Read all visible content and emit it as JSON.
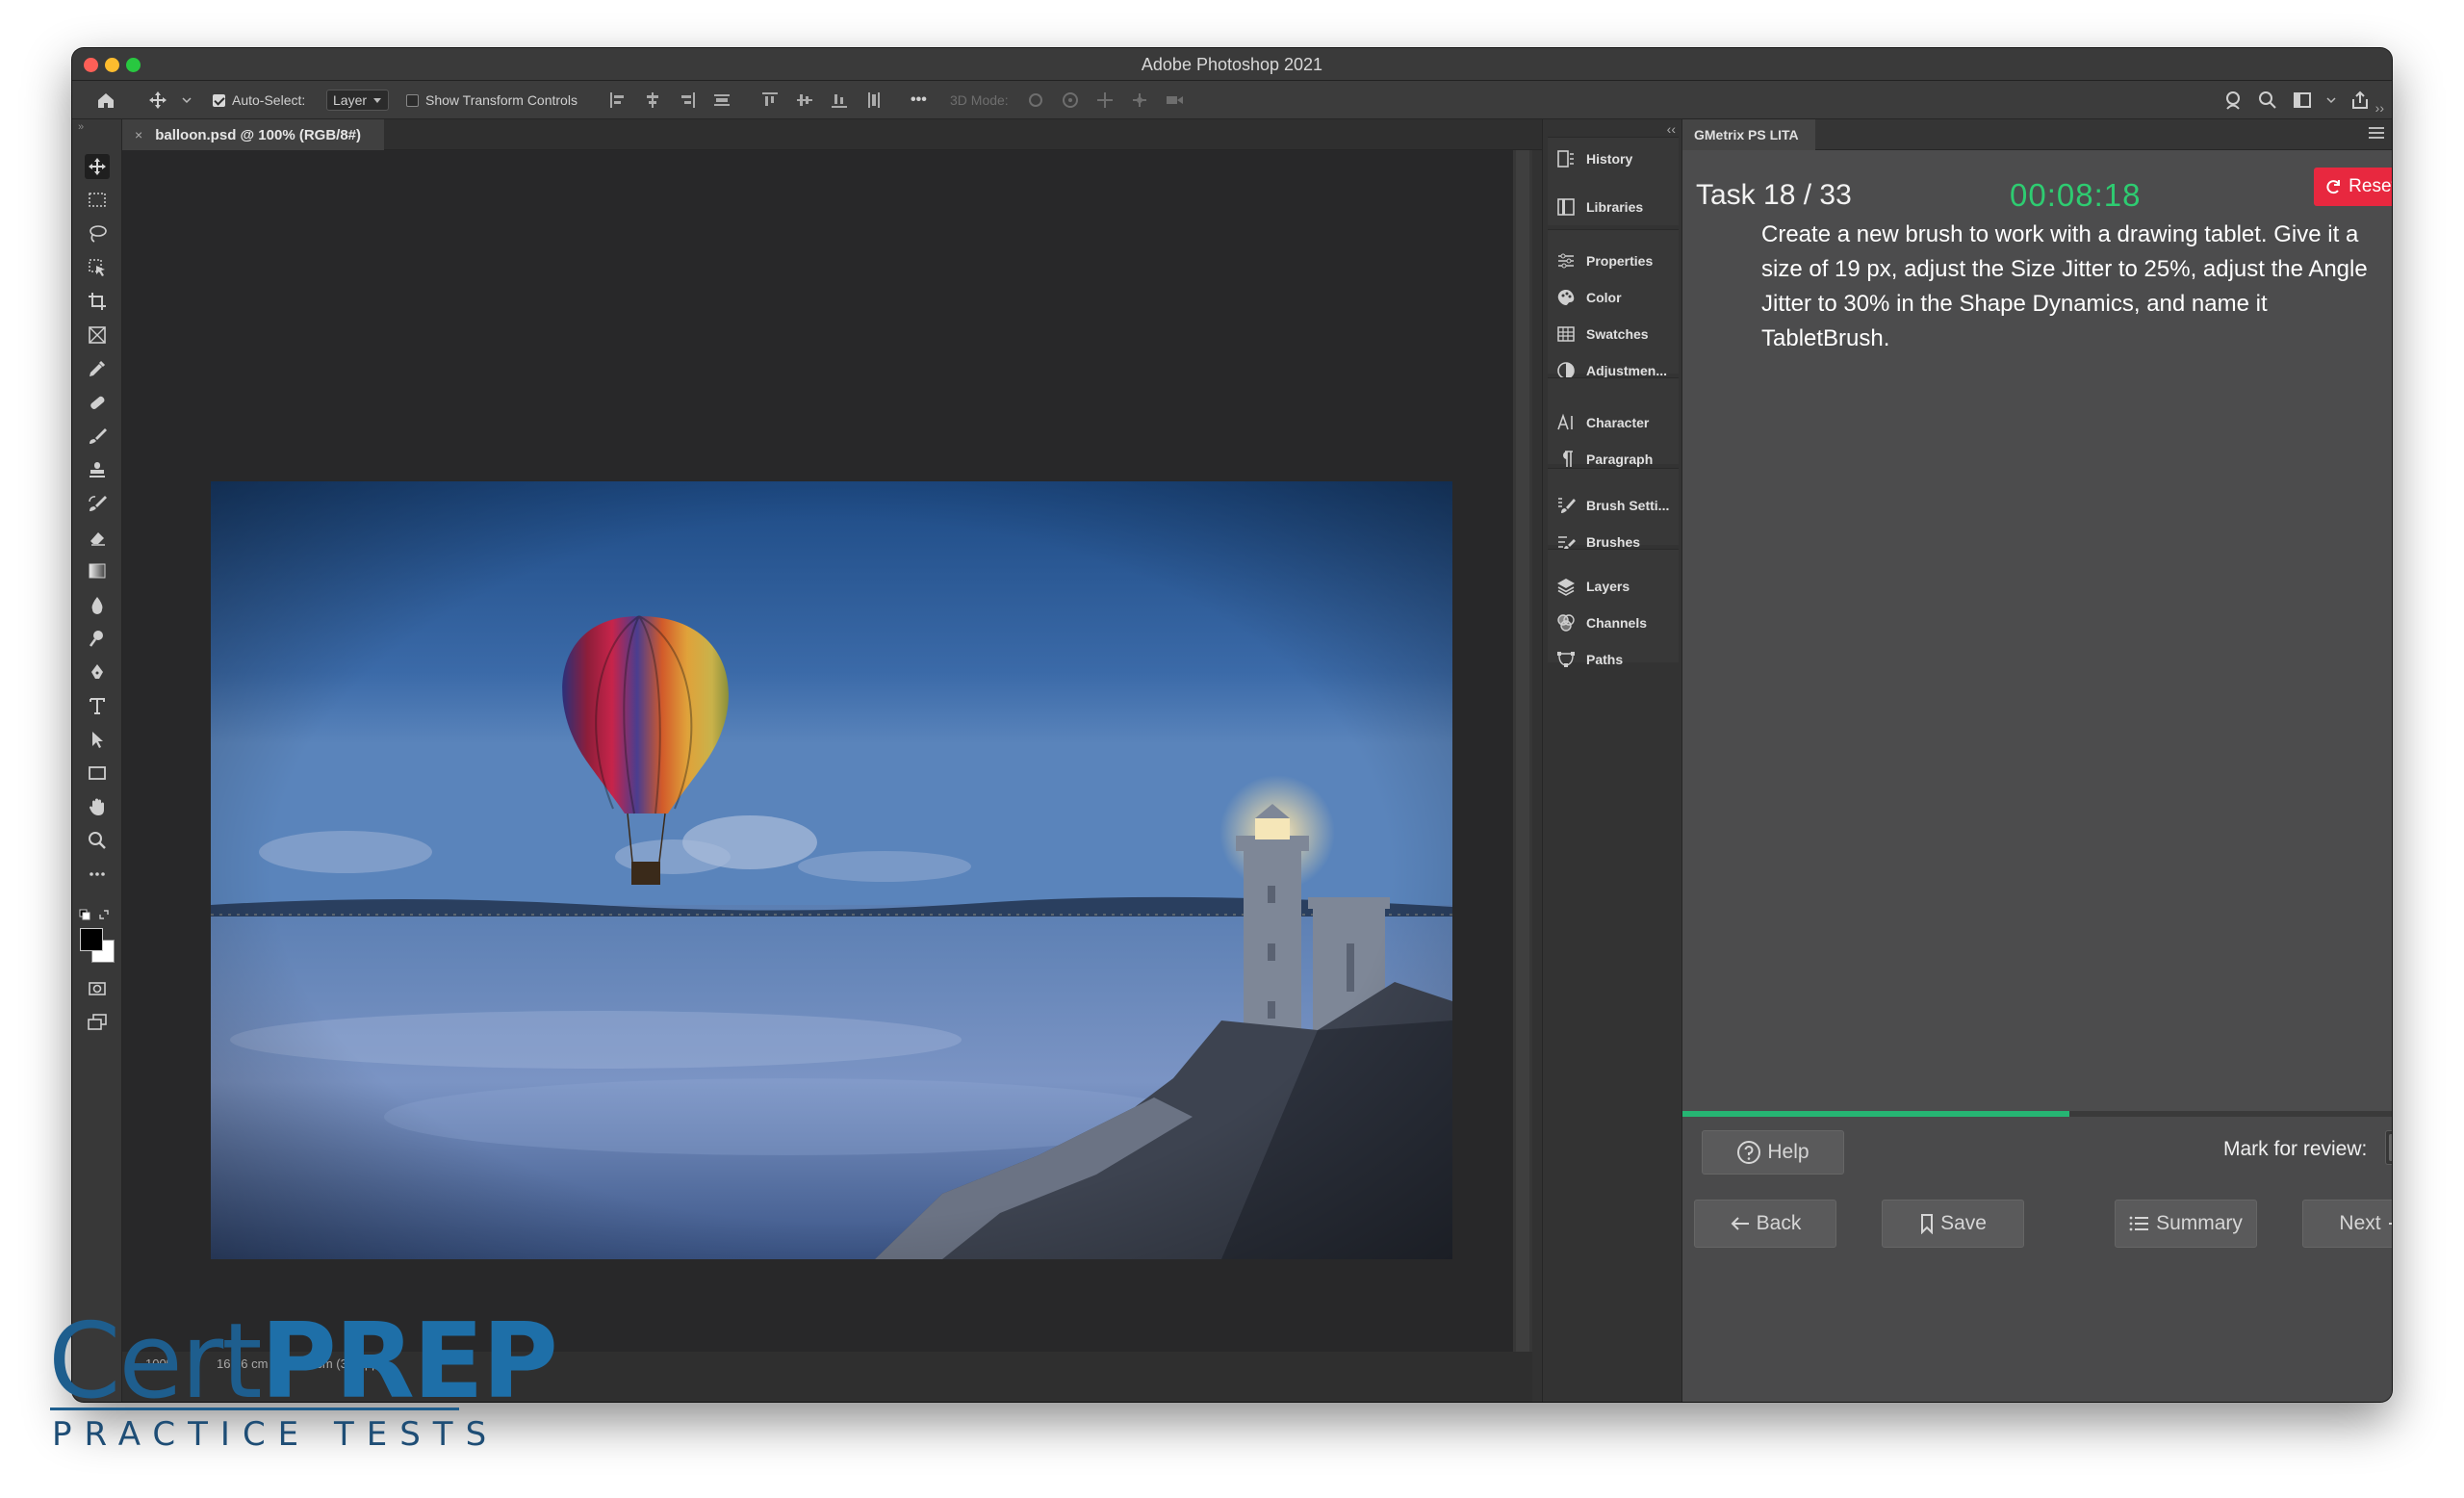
{
  "window": {
    "title": "Adobe Photoshop 2021"
  },
  "options_bar": {
    "auto_select_label": "Auto-Select:",
    "auto_select_checked": true,
    "auto_select_value": "Layer",
    "show_transform_label": "Show Transform Controls",
    "show_transform_checked": false,
    "more_label": "•••",
    "mode_3d_label": "3D Mode:"
  },
  "document": {
    "tab_title": "balloon.psd @ 100% (RGB/8#)",
    "close_glyph": "×",
    "zoom": "100%",
    "doc_size": "16.26 cm x 10.16 cm (300 ppi)",
    "status_arrow": "›"
  },
  "tools": [
    "move-tool-icon",
    "rectangular-marquee-icon",
    "lasso-icon",
    "object-selection-icon",
    "crop-icon",
    "frame-icon",
    "eyedropper-icon",
    "healing-brush-icon",
    "brush-icon",
    "clone-stamp-icon",
    "history-brush-icon",
    "eraser-icon",
    "gradient-icon",
    "blur-icon",
    "dodge-icon",
    "pen-icon",
    "type-icon",
    "path-selection-icon",
    "rectangle-icon",
    "hand-icon",
    "zoom-icon",
    "edit-toolbar-icon"
  ],
  "panels": {
    "history": "History",
    "libraries": "Libraries",
    "properties": "Properties",
    "color": "Color",
    "swatches": "Swatches",
    "adjustments": "Adjustmen...",
    "character": "Character",
    "paragraph": "Paragraph",
    "brush_settings": "Brush Setti...",
    "brushes": "Brushes",
    "layers": "Layers",
    "channels": "Channels",
    "paths": "Paths"
  },
  "gmetrix": {
    "tab_label": "GMetrix PS LITA",
    "task_label": "Task 18 / 33",
    "task_current": 18,
    "task_total": 33,
    "timer": "00:08:18",
    "reset_label": "Reset Task",
    "task_text": "Create a new brush to work with a drawing tablet. Give it a size of 19 px, adjust the Size Jitter to 25%, adjust the Angle Jitter to 30% in the Shape Dynamics, and name it TabletBrush.",
    "progress_fraction": 0.545,
    "help_label": "Help",
    "mark_review_label": "Mark for review:",
    "mark_review_on": false,
    "back_label": "Back",
    "save_label": "Save",
    "summary_label": "Summary",
    "next_label": "Next"
  },
  "logo": {
    "brand_part1": "Cert",
    "brand_part2": "PREP",
    "subtitle": "PRACTICE TESTS"
  },
  "colors": {
    "timer_green": "#2ecc71",
    "reset_red": "#e8283f",
    "progress_green": "#26b573",
    "logo_blue": "#1e5e8e"
  }
}
